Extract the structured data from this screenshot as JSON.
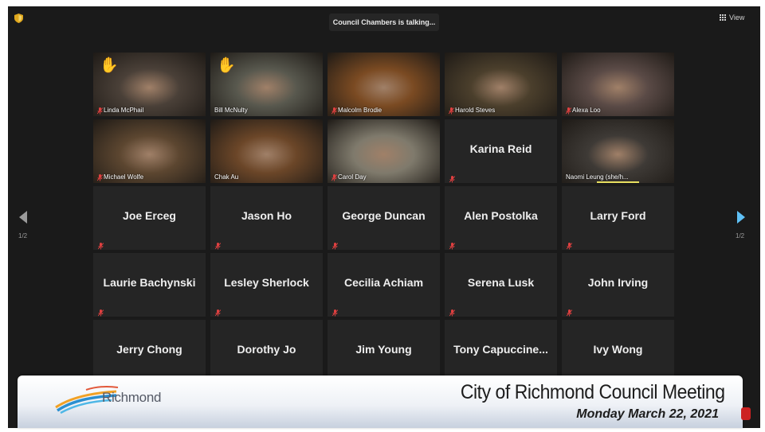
{
  "status": {
    "talking": "Council Chambers is talking..."
  },
  "toolbar": {
    "view_label": "View"
  },
  "pagination": {
    "left": "1/2",
    "right": "1/2"
  },
  "video_tiles": [
    {
      "name": "Linda McPhail",
      "hand_raised": true,
      "muted": true,
      "bg": "#4a4038"
    },
    {
      "name": "Bill McNulty",
      "hand_raised": true,
      "muted": false,
      "bg": "#58584e"
    },
    {
      "name": "Malcolm Brodie",
      "hand_raised": false,
      "muted": true,
      "bg": "#7a4a22"
    },
    {
      "name": "Harold Steves",
      "hand_raised": false,
      "muted": true,
      "bg": "#4b3f2c"
    },
    {
      "name": "Alexa Loo",
      "hand_raised": false,
      "muted": true,
      "bg": "#5a4a46"
    },
    {
      "name": "Michael Wolfe",
      "hand_raised": false,
      "muted": true,
      "bg": "#5c4630"
    },
    {
      "name": "Chak Au",
      "hand_raised": false,
      "muted": false,
      "bg": "#6b4628"
    },
    {
      "name": "Carol Day",
      "hand_raised": false,
      "muted": true,
      "bg": "#7f7a6c"
    },
    {
      "name": "Naomi Leung (she/h...",
      "hand_raised": false,
      "muted": false,
      "bg": "#3e3a36",
      "speaking": true
    }
  ],
  "name_tiles": [
    {
      "name": "Karina Reid"
    },
    {
      "name": "Joe Erceg"
    },
    {
      "name": "Jason Ho"
    },
    {
      "name": "George Duncan"
    },
    {
      "name": "Alen Postolka"
    },
    {
      "name": "Larry Ford"
    },
    {
      "name": "Laurie Bachynski"
    },
    {
      "name": "Lesley Sherlock"
    },
    {
      "name": "Cecilia Achiam"
    },
    {
      "name": "Serena Lusk"
    },
    {
      "name": "John Irving"
    },
    {
      "name": "Jerry Chong"
    },
    {
      "name": "Dorothy Jo"
    },
    {
      "name": "Jim Young"
    },
    {
      "name": "Tony  Capuccine..."
    },
    {
      "name": "Ivy Wong"
    }
  ],
  "banner": {
    "logo_text": "Richmond",
    "title": "City of Richmond Council Meeting",
    "date": "Monday March 22, 2021"
  },
  "colors": {
    "accent": "#5fc0f5",
    "muted_mic": "#e04040",
    "hand": "#f5c23a"
  }
}
